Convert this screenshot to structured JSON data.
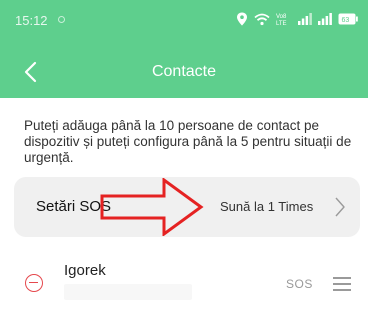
{
  "status_bar": {
    "time": "15:12",
    "icons": [
      "location-icon",
      "wifi-icon",
      "volte-icon",
      "signal-icon",
      "signal-icon",
      "battery-icon"
    ],
    "volte_text": "Vo8 LTE",
    "battery_level": "63"
  },
  "header": {
    "title": "Contacte",
    "background": "#5ecf8d"
  },
  "info": {
    "text": "Puteți adăuga până la 10 persoane de contact pe dispozitiv și puteți configura până la 5 pentru situații de urgență."
  },
  "sos_setting": {
    "label": "Setări SOS",
    "value": "Sună la 1 Times",
    "arrow_color": "#e52222"
  },
  "contacts": [
    {
      "name": "Igorek",
      "tag": "SOS"
    }
  ],
  "colors": {
    "accent": "#5ecf8d",
    "remove": "#e5484d",
    "card": "#f0f0f0"
  }
}
